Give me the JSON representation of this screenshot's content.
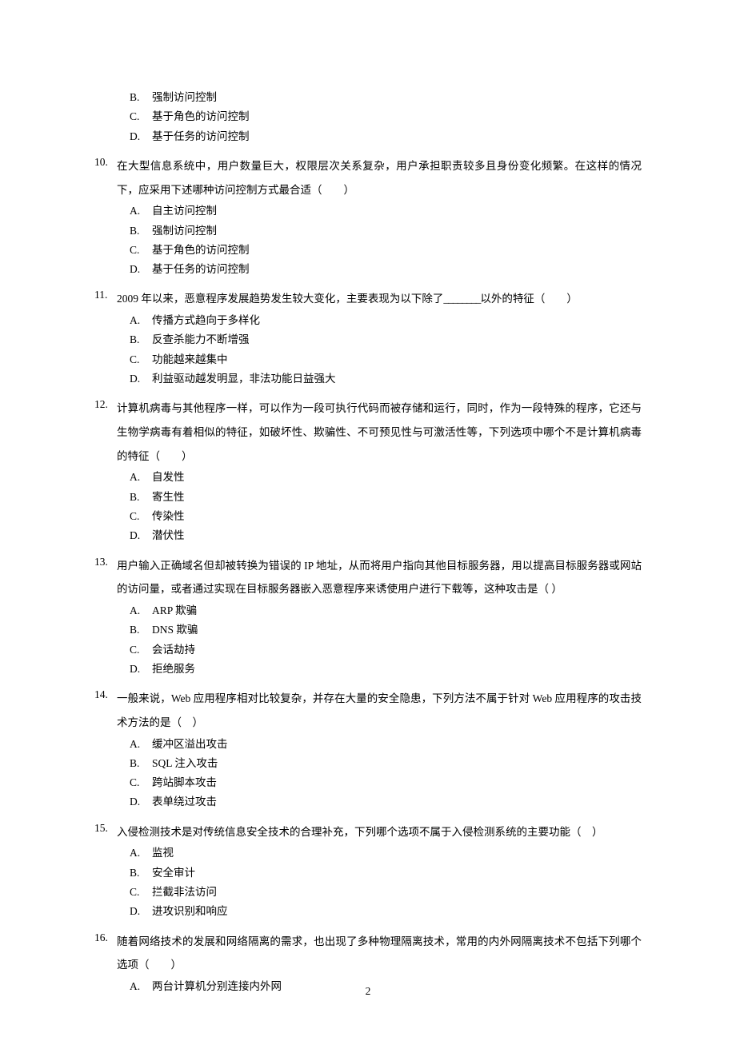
{
  "partial_prev": {
    "options": [
      {
        "label": "B.",
        "text": "强制访问控制"
      },
      {
        "label": "C.",
        "text": "基于角色的访问控制"
      },
      {
        "label": "D.",
        "text": "基于任务的访问控制"
      }
    ]
  },
  "questions": [
    {
      "num": "10.",
      "stem": "在大型信息系统中，用户数量巨大，权限层次关系复杂，用户承担职责较多且身份变化频繁。在这样的情况下，应采用下述哪种访问控制方式最合适（　　）",
      "options": [
        {
          "label": "A.",
          "text": "自主访问控制"
        },
        {
          "label": "B.",
          "text": "强制访问控制"
        },
        {
          "label": "C.",
          "text": "基于角色的访问控制"
        },
        {
          "label": "D.",
          "text": "基于任务的访问控制"
        }
      ]
    },
    {
      "num": "11.",
      "stem_before": "2009 年以来，恶意程序发展趋势发生较大变化，主要表现为以下除了",
      "blank": "________",
      "stem_after": "以外的特征（　　）",
      "options": [
        {
          "label": "A.",
          "text": "传播方式趋向于多样化"
        },
        {
          "label": "B.",
          "text": "反查杀能力不断增强"
        },
        {
          "label": "C.",
          "text": "功能越来越集中"
        },
        {
          "label": "D.",
          "text": "利益驱动越发明显，非法功能日益强大"
        }
      ]
    },
    {
      "num": "12.",
      "stem": "计算机病毒与其他程序一样，可以作为一段可执行代码而被存储和运行，同时，作为一段特殊的程序，它还与生物学病毒有着相似的特征，如破坏性、欺骗性、不可预见性与可激活性等，下列选项中哪个不是计算机病毒的特征（　　）",
      "options": [
        {
          "label": "A.",
          "text": "自发性"
        },
        {
          "label": "B.",
          "text": "寄生性"
        },
        {
          "label": "C.",
          "text": "传染性"
        },
        {
          "label": "D.",
          "text": "潜伏性"
        }
      ]
    },
    {
      "num": "13.",
      "stem": "用户输入正确域名但却被转换为错误的 IP 地址，从而将用户指向其他目标服务器，用以提高目标服务器或网站的访问量，或者通过实现在目标服务器嵌入恶意程序来诱使用户进行下载等，这种攻击是（ ）",
      "options": [
        {
          "label": "A.",
          "text": "ARP 欺骗"
        },
        {
          "label": "B.",
          "text": "DNS 欺骗"
        },
        {
          "label": "C.",
          "text": "会话劫持"
        },
        {
          "label": "D.",
          "text": "拒绝服务"
        }
      ]
    },
    {
      "num": "14.",
      "stem": "一般来说，Web 应用程序相对比较复杂，并存在大量的安全隐患，下列方法不属于针对 Web 应用程序的攻击技术方法的是（　）",
      "options": [
        {
          "label": "A.",
          "text": "缓冲区溢出攻击"
        },
        {
          "label": "B.",
          "text": "SQL 注入攻击"
        },
        {
          "label": "C.",
          "text": "跨站脚本攻击"
        },
        {
          "label": "D.",
          "text": "表单绕过攻击"
        }
      ]
    },
    {
      "num": "15.",
      "stem": "入侵检测技术是对传统信息安全技术的合理补充，下列哪个选项不属于入侵检测系统的主要功能（　）",
      "options": [
        {
          "label": "A.",
          "text": "监视"
        },
        {
          "label": "B.",
          "text": "安全审计"
        },
        {
          "label": "C.",
          "text": "拦截非法访问"
        },
        {
          "label": "D.",
          "text": "进攻识别和响应"
        }
      ]
    },
    {
      "num": "16.",
      "stem": "随着网络技术的发展和网络隔离的需求，也出现了多种物理隔离技术，常用的内外网隔离技术不包括下列哪个选项（　　）",
      "options": [
        {
          "label": "A.",
          "text": "两台计算机分别连接内外网"
        }
      ]
    }
  ],
  "page_number": "2"
}
